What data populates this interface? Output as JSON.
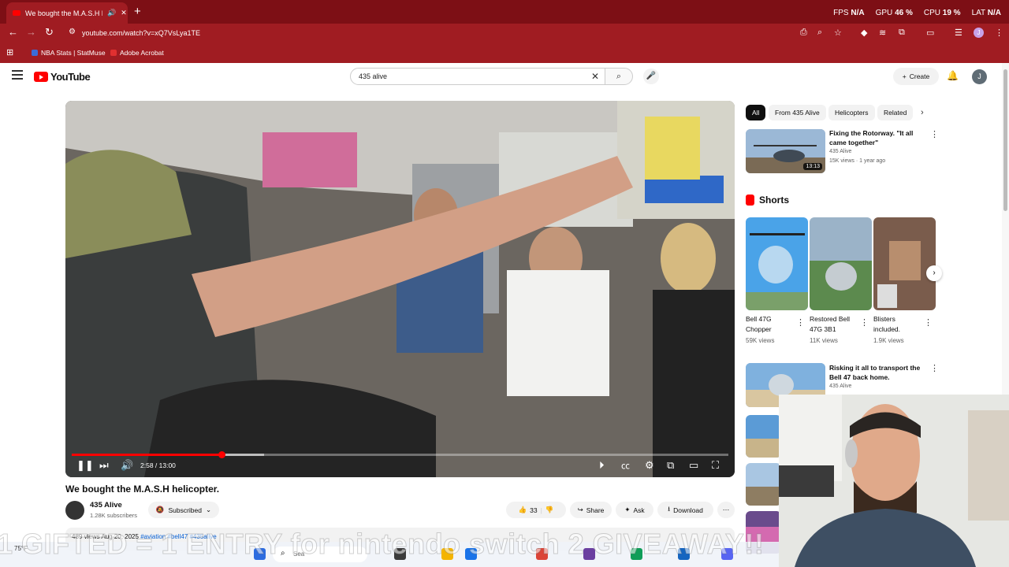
{
  "browser": {
    "tab_title": "We bought the M.A.S.H heli",
    "new_tab": "+",
    "url": "youtube.com/watch?v=xQ7VsLya1TE",
    "profile_initial": "J",
    "bookmarks": [
      "NBA Stats | StatMuse",
      "Adobe Acrobat"
    ],
    "perf": [
      {
        "label": "FPS",
        "value": "N/A"
      },
      {
        "label": "GPU",
        "value": "46 %"
      },
      {
        "label": "CPU",
        "value": "19 %"
      },
      {
        "label": "LAT",
        "value": "N/A"
      }
    ],
    "colors": {
      "chrome": "#a01c22",
      "tabbar": "#7d0f15"
    }
  },
  "youtube": {
    "logo_text": "YouTube",
    "search_query": "435 alive",
    "create_label": "Create",
    "avatar_initial": "J"
  },
  "video": {
    "current_time": "2:58",
    "duration": "13:00",
    "time_display": "2:58 / 13:00",
    "progress_fraction": 0.228,
    "buffered_fraction": 0.293,
    "title": "We bought the M.A.S.H helicopter.",
    "channel_name": "435 Alive",
    "subscribers": "1.28K subscribers",
    "subscribed_label": "Subscribed",
    "like_count": "33",
    "share_label": "Share",
    "ask_label": "Ask",
    "download_label": "Download",
    "desc_views": "489 views",
    "desc_date": "Aug 20, 2025",
    "desc_tags": "#aviation #bell47 #435alive",
    "accent": "#ff0000"
  },
  "sidebar": {
    "chips": [
      "All",
      "From 435 Alive",
      "Helicopters",
      "Related"
    ],
    "recs": [
      {
        "title": "Fixing the Rotorway. \"It all came together\"",
        "channel": "435 Alive",
        "meta": "15K views · 1 year ago",
        "duration": "13:13"
      },
      {
        "title": "Risking it all to transport the Bell 47 back home.",
        "channel": "435 Alive"
      }
    ],
    "shorts_label": "Shorts",
    "shorts": [
      {
        "title": "Bell 47G Chopper",
        "views": "59K views"
      },
      {
        "title": "Restored Bell 47G 3B1",
        "views": "11K views"
      },
      {
        "title": "Blisters included.",
        "views": "1.9K views"
      }
    ]
  },
  "taskbar": {
    "search_placeholder": "Sea",
    "weather": "75°F"
  },
  "overlay_text": "1 GIFTED = 1 ENTRY for nintendo switch 2 GIVEAWAY!!"
}
